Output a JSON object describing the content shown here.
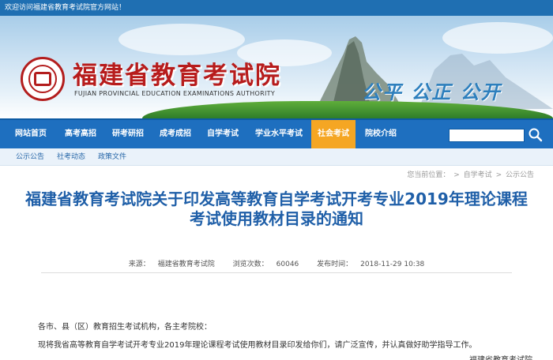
{
  "topbar": {
    "welcome": "欢迎访问福建省教育考试院官方网站！"
  },
  "header": {
    "site_name": "福建省教育考试院",
    "site_name_en": "FUJIAN PROVINCIAL EDUCATION EXAMINATIONS AUTHORITY",
    "slogan": "公平 公正 公开"
  },
  "nav": {
    "items": [
      {
        "label": "网站首页"
      },
      {
        "label": "高考高招"
      },
      {
        "label": "研考研招"
      },
      {
        "label": "成考成招"
      },
      {
        "label": "自学考试"
      },
      {
        "label": "学业水平考试"
      },
      {
        "label": "社会考试",
        "active": true
      },
      {
        "label": "院校介绍"
      }
    ],
    "search_placeholder": ""
  },
  "subnav": {
    "items": [
      {
        "label": "公示公告"
      },
      {
        "label": "社考动态"
      },
      {
        "label": "政策文件"
      }
    ]
  },
  "breadcrumb": {
    "prefix": "您当前位置：",
    "items": [
      "自学考试",
      "公示公告"
    ],
    "separator": ">"
  },
  "article": {
    "title_line1": "福建省教育考试院关于印发高等教育自学考试开考专业2019年理论课程",
    "title_line2": "考试使用教材目录的通知",
    "source_label": "来源：",
    "source": "福建省教育考试院",
    "views_label": "浏览次数：",
    "views": "60046",
    "published_label": "发布时间：",
    "published": "2018-11-29 10:38",
    "salutation": "各市、县（区）教育招生考试机构，各主考院校：",
    "paragraph1": "现将我省高等教育自学考试开考专业2019年理论课程考试使用教材目录印发给你们，请广泛宣传，并认真做好助学指导工作。",
    "signature": "福建省教育考试院"
  },
  "colors": {
    "brand_blue": "#1e6fbf",
    "active_orange": "#f5a623",
    "title_blue": "#1f5fa8",
    "logo_red": "#b71c1c"
  }
}
